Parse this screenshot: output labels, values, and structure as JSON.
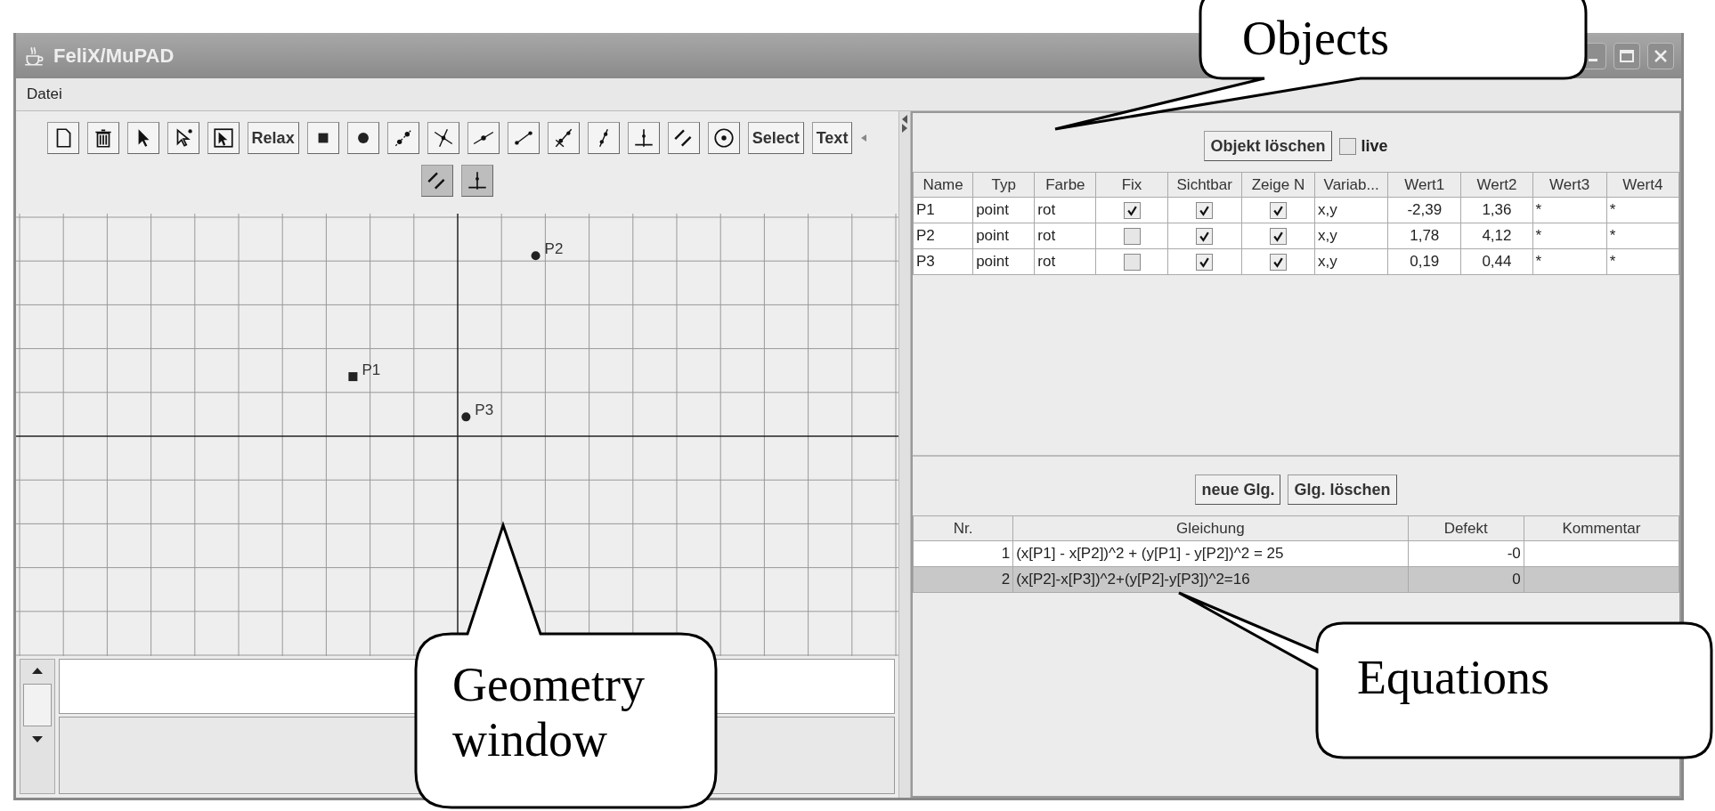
{
  "window": {
    "title": "FeliX/MuPAD"
  },
  "menu": [
    {
      "label": "Datei"
    }
  ],
  "toolbar": {
    "rows": [
      [
        {
          "kind": "icon",
          "pressed": false
        },
        {
          "kind": "icon",
          "pressed": false
        },
        {
          "kind": "icon",
          "pressed": false
        },
        {
          "kind": "icon",
          "pressed": false
        },
        {
          "kind": "icon",
          "pressed": false
        },
        {
          "kind": "text",
          "label": "Relax",
          "pressed": false
        },
        {
          "kind": "icon",
          "pressed": false
        },
        {
          "kind": "icon",
          "pressed": false
        },
        {
          "kind": "icon",
          "pressed": false
        },
        {
          "kind": "icon",
          "pressed": false
        },
        {
          "kind": "icon",
          "pressed": false
        },
        {
          "kind": "icon",
          "pressed": false
        },
        {
          "kind": "icon",
          "pressed": false
        },
        {
          "kind": "icon",
          "pressed": false
        },
        {
          "kind": "icon",
          "pressed": false
        },
        {
          "kind": "icon",
          "pressed": false
        },
        {
          "kind": "icon",
          "pressed": false
        },
        {
          "kind": "text",
          "label": "Select",
          "pressed": false
        },
        {
          "kind": "text",
          "label": "Text",
          "pressed": false
        }
      ],
      [
        {
          "kind": "icon",
          "pressed": true
        },
        {
          "kind": "icon",
          "pressed": true
        }
      ]
    ]
  },
  "geometry": {
    "points": [
      {
        "label": "P1"
      },
      {
        "label": "P2"
      },
      {
        "label": "P3"
      }
    ]
  },
  "objects_panel": {
    "delete_button": "Objekt löschen",
    "live": {
      "label": "live",
      "checked": false
    },
    "columns": [
      "Name",
      "Typ",
      "Farbe",
      "Fix",
      "Sichtbar",
      "Zeige N",
      "Variab...",
      "Wert1",
      "Wert2",
      "Wert3",
      "Wert4"
    ],
    "rows": [
      {
        "name": "P1",
        "type": "point",
        "farbe": "rot",
        "fix": true,
        "visible": true,
        "show_name": true,
        "variables": "x,y",
        "wert1": "-2,39",
        "wert2": "1,36",
        "wert3": "*",
        "wert4": "*"
      },
      {
        "name": "P2",
        "type": "point",
        "farbe": "rot",
        "fix": false,
        "visible": true,
        "show_name": true,
        "variables": "x,y",
        "wert1": "1,78",
        "wert2": "4,12",
        "wert3": "*",
        "wert4": "*"
      },
      {
        "name": "P3",
        "type": "point",
        "farbe": "rot",
        "fix": false,
        "visible": true,
        "show_name": true,
        "variables": "x,y",
        "wert1": "0,19",
        "wert2": "0,44",
        "wert3": "*",
        "wert4": "*"
      }
    ]
  },
  "equations_panel": {
    "buttons": [
      "neue Glg.",
      "Glg. löschen"
    ],
    "columns": [
      "Nr.",
      "Gleichung",
      "Defekt",
      "Kommentar"
    ],
    "rows": [
      {
        "nr": "1",
        "equation": "(x[P1] - x[P2])^2 + (y[P1] - y[P2])^2 = 25",
        "defect": "-0",
        "selected": false
      },
      {
        "nr": "2",
        "equation": "(x[P2]-x[P3])^2+(y[P2]-y[P3])^2=16",
        "defect": "0",
        "selected": true
      }
    ]
  },
  "callouts": [
    {
      "text": "Objects"
    },
    {
      "text": "Geometry window"
    },
    {
      "text": "Equations"
    }
  ]
}
